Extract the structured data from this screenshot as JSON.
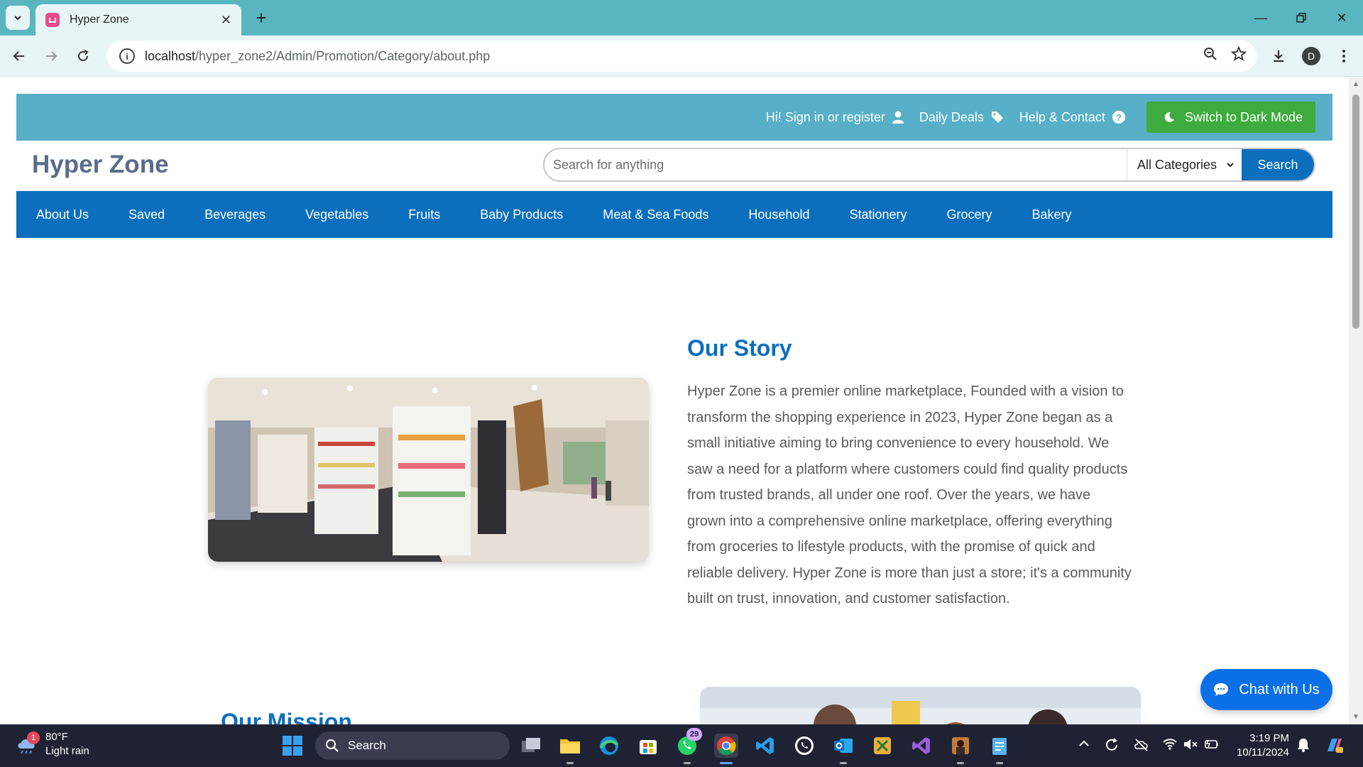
{
  "browser": {
    "tab_title": "Hyper Zone",
    "url_host": "localhost",
    "url_path": "/hyper_zone2/Admin/Promotion/Category/about.php",
    "profile_initial": "D"
  },
  "topbar": {
    "sign_in": "Hi! Sign in or register",
    "daily_deals": "Daily Deals",
    "help": "Help & Contact",
    "dark_mode": "Switch to Dark Mode"
  },
  "header": {
    "logo": "Hyper Zone",
    "search_placeholder": "Search for anything",
    "category_selected": "All Categories",
    "search_button": "Search"
  },
  "nav": {
    "items": [
      "About Us",
      "Saved",
      "Beverages",
      "Vegetables",
      "Fruits",
      "Baby Products",
      "Meat & Sea Foods",
      "Household",
      "Stationery",
      "Grocery",
      "Bakery"
    ]
  },
  "story": {
    "title": "Our Story",
    "body": "Hyper Zone is a premier online marketplace, Founded with a vision to transform the shopping experience in 2023, Hyper Zone began as a small initiative aiming to bring convenience to every household. We saw a need for a platform where customers could find quality products from trusted brands, all under one roof. Over the years, we have grown into a comprehensive online marketplace, offering everything from groceries to lifestyle products, with the promise of quick and reliable delivery. Hyper Zone is more than just a store; it's a community built on trust, innovation, and customer satisfaction."
  },
  "mission": {
    "title": "Our Mission"
  },
  "chat": {
    "label": "Chat with Us"
  },
  "taskbar": {
    "weather_temp": "80°F",
    "weather_desc": "Light rain",
    "weather_badge": "1",
    "search_label": "Search",
    "whatsapp_badge": "29",
    "time": "3:19 PM",
    "date": "10/11/2024"
  },
  "colors": {
    "topbar": "#57afc8",
    "nav": "#0b6fbd",
    "dark_mode_button": "#3dab3d",
    "chat_button": "#0b6fe8",
    "tab_strip": "#59b6c0"
  }
}
